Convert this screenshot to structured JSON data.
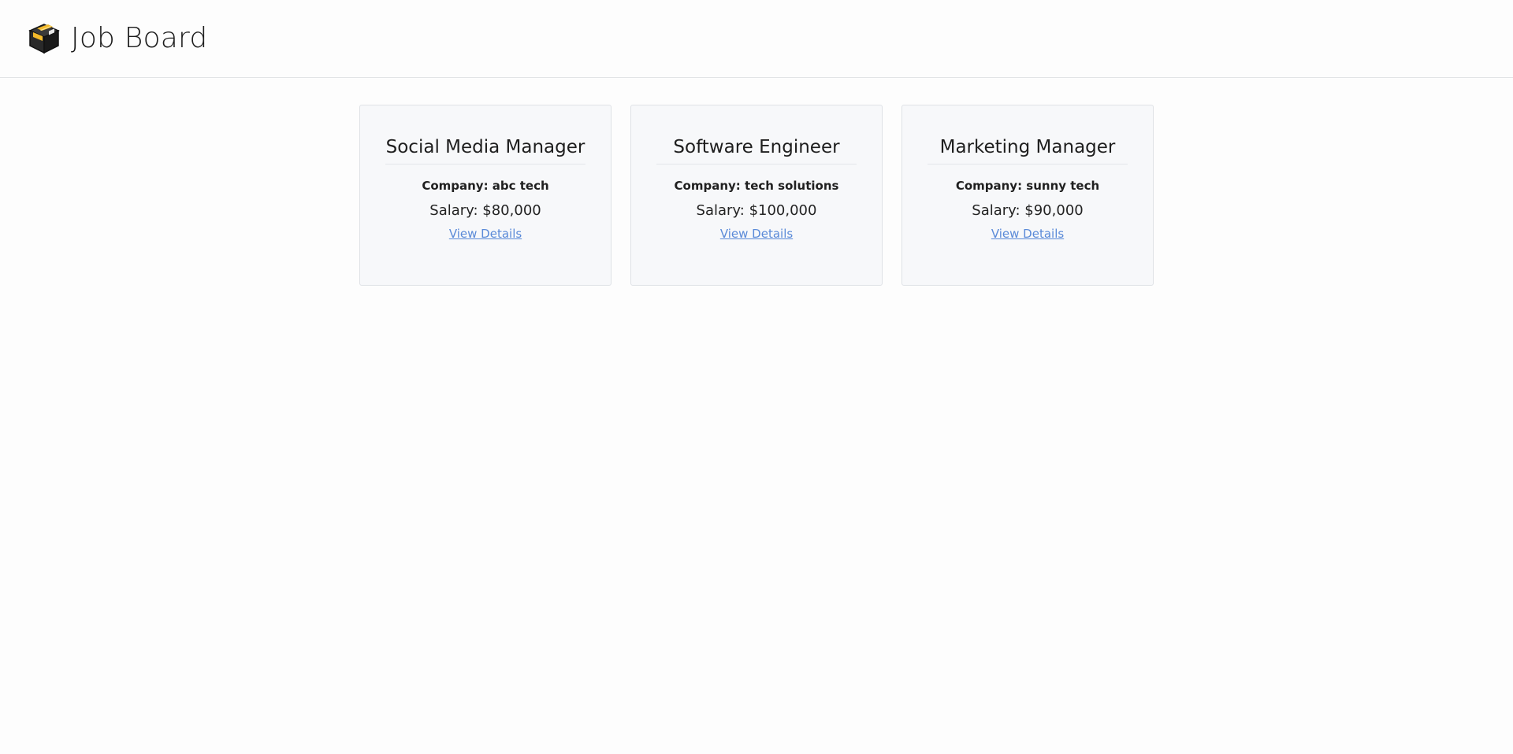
{
  "header": {
    "title": "Job Board",
    "logo_icon": "box-icon"
  },
  "jobs": [
    {
      "title": "Social Media Manager",
      "company": "Company: abc tech",
      "salary": "Salary: $80,000",
      "link": "View Details"
    },
    {
      "title": "Software Engineer",
      "company": "Company: tech solutions",
      "salary": "Salary: $100,000",
      "link": "View Details"
    },
    {
      "title": "Marketing Manager",
      "company": "Company: sunny tech",
      "salary": "Salary: $90,000",
      "link": "View Details"
    }
  ],
  "colors": {
    "link": "#5a8ad8",
    "card_bg": "#f7f8fa",
    "card_border": "#dfe2e6",
    "logo_accent": "#f2b92b"
  }
}
